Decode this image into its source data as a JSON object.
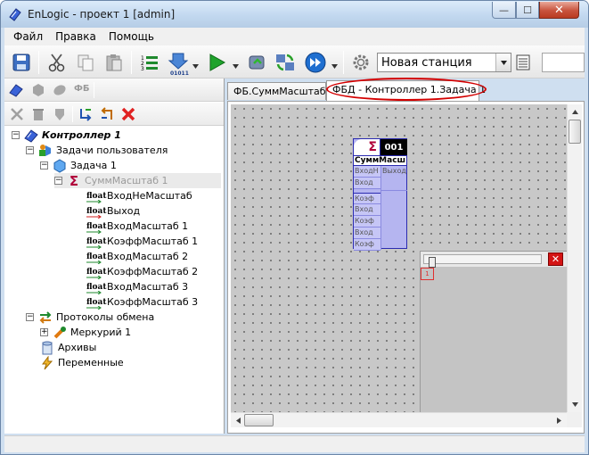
{
  "window": {
    "title": "EnLogic - проект 1 [admin]",
    "close_glyph": "✕",
    "min_glyph": "—",
    "max_glyph": "☐"
  },
  "menu": {
    "items": [
      {
        "label": "Файл"
      },
      {
        "label": "Правка"
      },
      {
        "label": "Помощь"
      }
    ]
  },
  "toolbar": {
    "station": "Новая станция",
    "counter_label": "01011"
  },
  "left_toolbar": {
    "fb_label": "ФБ"
  },
  "tree": {
    "controller": "Контроллер 1",
    "user_tasks": "Задачи пользователя",
    "task": "Задача 1",
    "fb": "СуммМасштаб 1",
    "vars": [
      "ВходНеМасштаб",
      "Выход",
      "ВходМасштаб 1",
      "КоэффМасштаб 1",
      "ВходМасштаб 2",
      "КоэффМасштаб 2",
      "ВходМасштаб 3",
      "КоэффМасштаб 3"
    ],
    "float_label": "float",
    "protocols": "Протоколы обмена",
    "mercury": "Меркурий 1",
    "archives": "Архивы",
    "variables": "Переменные",
    "toggle_minus": "−",
    "toggle_plus": "+"
  },
  "tabs": [
    {
      "label": "ФБ.СуммМасштаб 1"
    },
    {
      "label": "ФБД - Контроллер 1.Задача 1"
    }
  ],
  "fb_block": {
    "sigma": "Σ",
    "number": "001",
    "name": "СуммМасш",
    "inputs": [
      "ВходН",
      "Вход",
      "Коэф",
      "Вход",
      "Коэф",
      "Вход",
      "Коэф"
    ],
    "output": "Выход"
  },
  "mini_panel": {
    "close": "✕",
    "marker": "1"
  },
  "colors": {
    "accent": "#2b2bb0",
    "highlight": "#d40000"
  }
}
